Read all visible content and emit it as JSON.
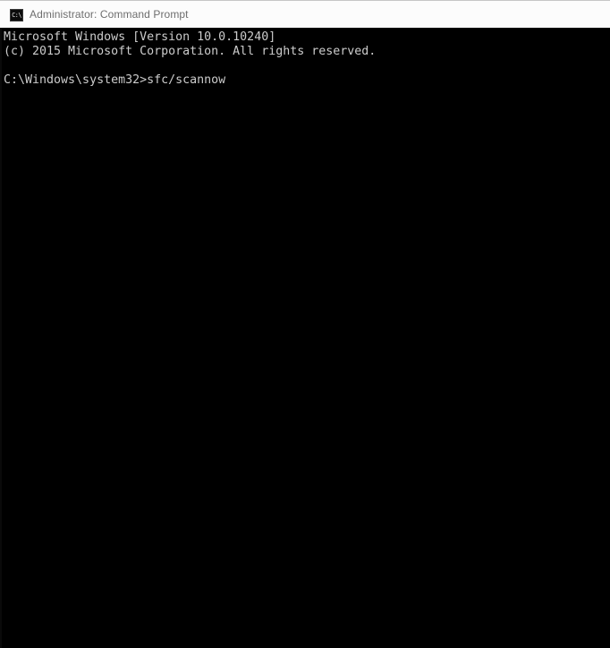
{
  "window": {
    "title": "Administrator: Command Prompt",
    "icon": "cmd-icon",
    "icon_glyph": "C:\\",
    "titlebar_bg": "#fcfcfc",
    "titlebar_text_color": "#6e6e6e"
  },
  "console": {
    "background": "#000000",
    "foreground": "#cccccc",
    "lines": [
      "Microsoft Windows [Version 10.0.10240]",
      "(c) 2015 Microsoft Corporation. All rights reserved.",
      "",
      "C:\\Windows\\system32>sfc/scannow"
    ],
    "text": "Microsoft Windows [Version 10.0.10240]\n(c) 2015 Microsoft Corporation. All rights reserved.\n\nC:\\Windows\\system32>sfc/scannow",
    "banner_version": "10.0.10240",
    "copyright_year": "2015",
    "prompt_path": "C:\\Windows\\system32>",
    "command": "sfc/scannow"
  }
}
